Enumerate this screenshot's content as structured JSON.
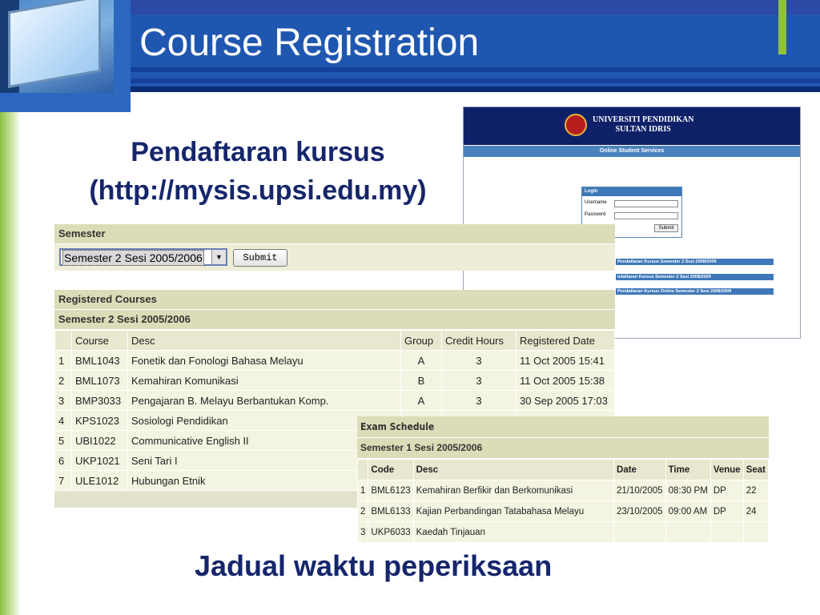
{
  "slide": {
    "title": "Course Registration",
    "subtitle_line1": "Pendaftaran kursus",
    "subtitle_line2": "(http://mysis.upsi.edu.my)",
    "caption": "Jadual waktu peperiksaan"
  },
  "portal": {
    "university_line1": "UNIVERSITI PENDIDIKAN",
    "university_line2": "SULTAN IDRIS",
    "band_title": "Online Student Services",
    "login": {
      "title": "Login",
      "username_label": "Username",
      "password_label": "Password",
      "submit_label": "Submit"
    },
    "links": [
      "Pendaftaran Kursus Semester 2 Sesi 2008/2009",
      "ndaftaran Kursus Semester 2 Sesi 2008/2009",
      "Pendaftaran Kursus Online Semester 2 Sesi 2008/2009"
    ]
  },
  "semester_form": {
    "header": "Semester",
    "selected": "Semester 2 Sesi 2005/2006",
    "submit_label": "Submit"
  },
  "registered_courses": {
    "title": "Registered Courses",
    "session": "Semester 2 Sesi 2005/2006",
    "columns": [
      "",
      "Course",
      "Desc",
      "Group",
      "Credit Hours",
      "Registered Date"
    ],
    "rows": [
      [
        "1",
        "BML1043",
        "Fonetik dan Fonologi Bahasa Melayu",
        "A",
        "3",
        "11 Oct 2005 15:41"
      ],
      [
        "2",
        "BML1073",
        "Kemahiran Komunikasi",
        "B",
        "3",
        "11 Oct 2005 15:38"
      ],
      [
        "3",
        "BMP3033",
        "Pengajaran B. Melayu Berbantukan Komp.",
        "A",
        "3",
        "30 Sep 2005 17:03"
      ],
      [
        "4",
        "KPS1023",
        "Sosiologi Pendidikan",
        "",
        "",
        ""
      ],
      [
        "5",
        "UBI1022",
        "Communicative English II",
        "",
        "",
        ""
      ],
      [
        "6",
        "UKP1021",
        "Seni Tari I",
        "",
        "",
        ""
      ],
      [
        "7",
        "ULE1012",
        "Hubungan Etnik",
        "",
        "",
        ""
      ]
    ]
  },
  "exam_schedule": {
    "title": "Exam Schedule",
    "session": "Semester 1 Sesi 2005/2006",
    "columns": [
      "",
      "Code",
      "Desc",
      "Date",
      "Time",
      "Venue",
      "Seat"
    ],
    "rows": [
      [
        "1",
        "BML6123",
        "Kemahiran Berfikir dan Berkomunikasi",
        "21/10/2005",
        "08:30 PM",
        "DP",
        "22"
      ],
      [
        "2",
        "BML6133",
        "Kajian Perbandingan Tatabahasa Melayu",
        "23/10/2005",
        "09:00 AM",
        "DP",
        "24"
      ],
      [
        "3",
        "UKP6033",
        "Kaedah Tinjauan",
        "",
        "",
        "",
        ""
      ]
    ]
  },
  "colors": {
    "header_blue": "#1f57b0",
    "title_navy": "#15266b",
    "accent_green": "#8fc13e",
    "panel_olive": "#dddcb8"
  }
}
